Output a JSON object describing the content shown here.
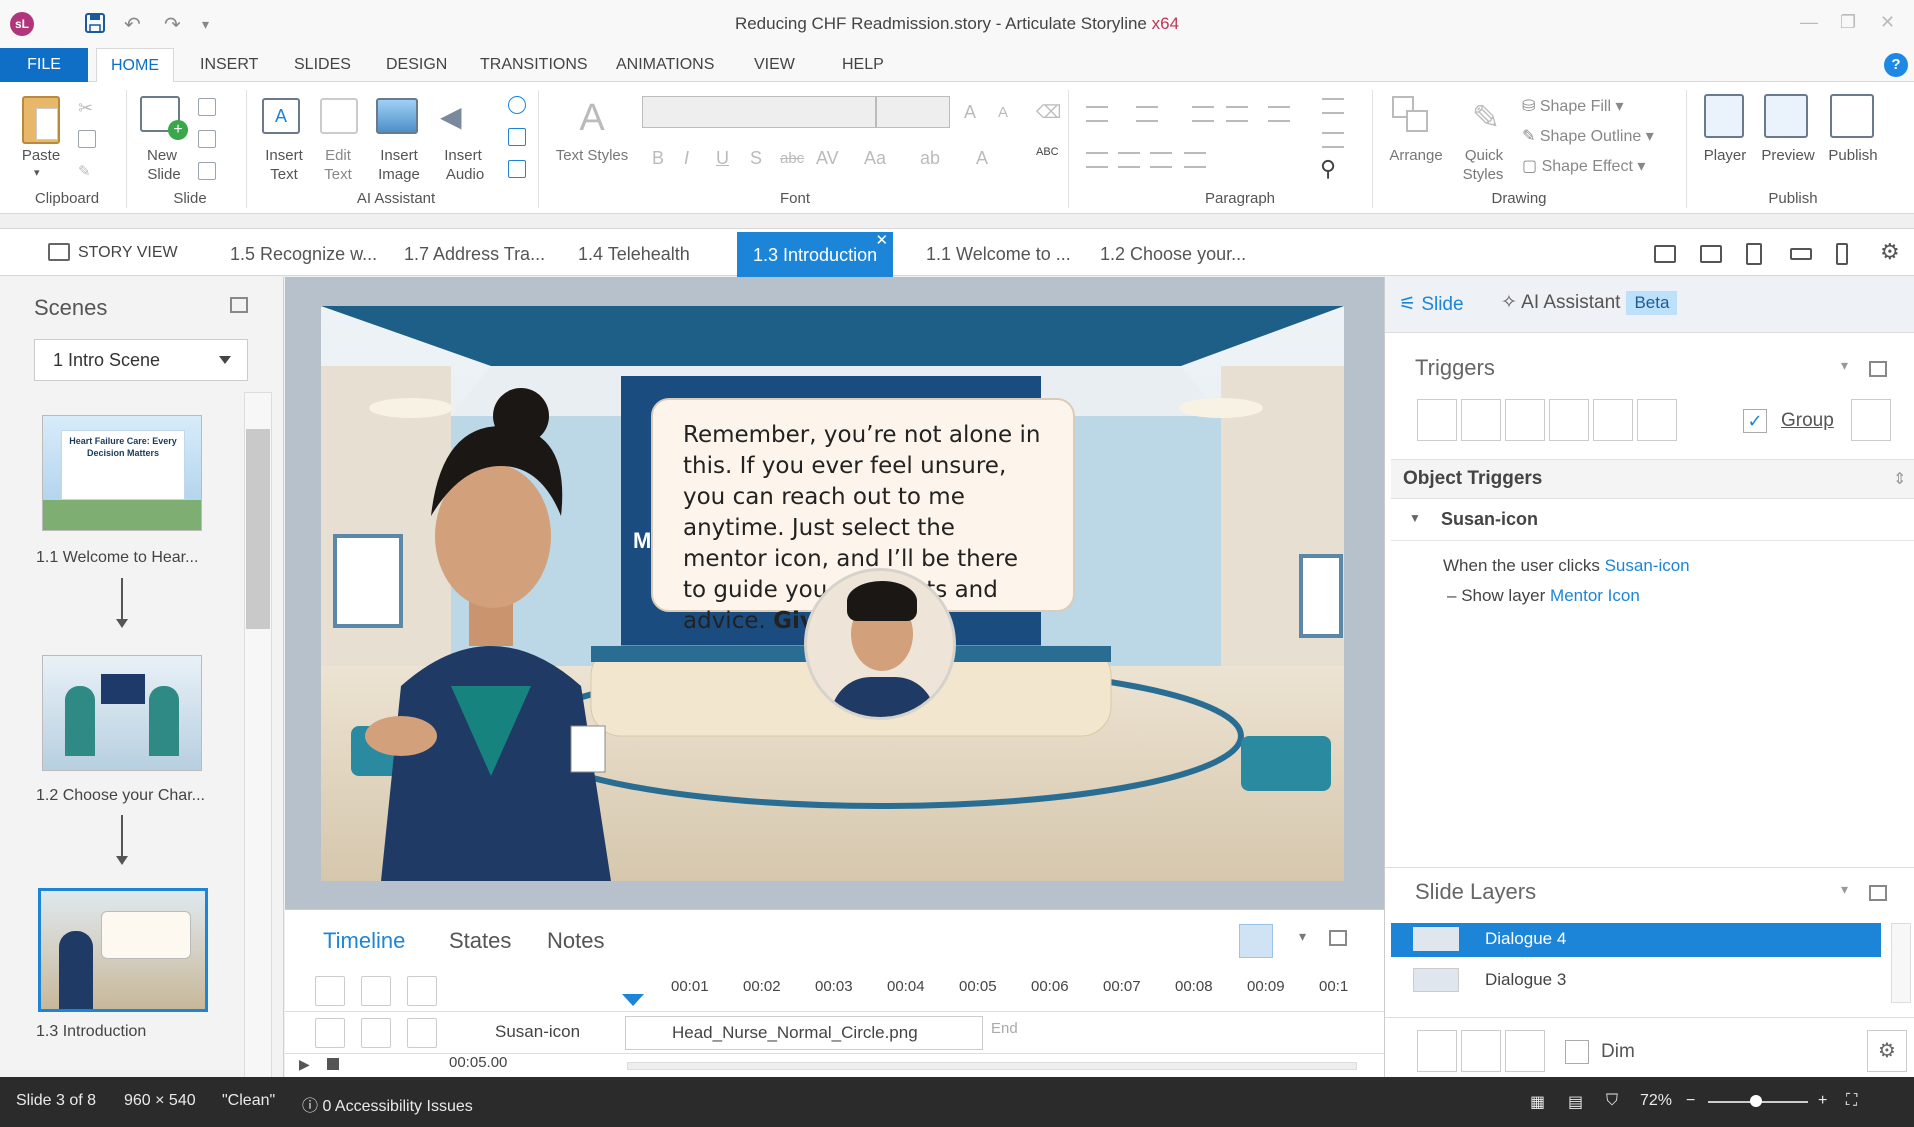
{
  "app": {
    "logo_text": "sL",
    "title": "Reducing CHF Readmission.story - Articulate Storyline",
    "arch": "x64"
  },
  "ribbon_tabs": [
    "FILE",
    "HOME",
    "INSERT",
    "SLIDES",
    "DESIGN",
    "TRANSITIONS",
    "ANIMATIONS",
    "VIEW",
    "HELP"
  ],
  "ribbon": {
    "paste": "Paste",
    "clipboard": "Clipboard",
    "new_slide_1": "New",
    "new_slide_2": "Slide",
    "slide_group": "Slide",
    "insert_text_1": "Insert",
    "insert_text_2": "Text",
    "edit_text_1": "Edit",
    "edit_text_2": "Text",
    "insert_image_1": "Insert",
    "insert_image_2": "Image",
    "insert_audio_1": "Insert",
    "insert_audio_2": "Audio",
    "ai_group": "AI Assistant",
    "text_styles": "Text Styles",
    "font_group": "Font",
    "paragraph_group": "Paragraph",
    "arrange": "Arrange",
    "quick_styles_1": "Quick",
    "quick_styles_2": "Styles",
    "shape_fill": "Shape Fill",
    "shape_outline": "Shape Outline",
    "shape_effect": "Shape Effect",
    "drawing_group": "Drawing",
    "player": "Player",
    "preview": "Preview",
    "publish": "Publish",
    "publish_group": "Publish"
  },
  "slide_tabs": {
    "story_view": "STORY VIEW",
    "tabs": [
      "1.5 Recognize w...",
      "1.7 Address Tra...",
      "1.4 Telehealth",
      "1.3 Introduction",
      "1.1 Welcome to ...",
      "1.2 Choose your..."
    ],
    "active_index": 3
  },
  "scenes": {
    "title": "Scenes",
    "selected_scene": "1 Intro Scene",
    "slides": [
      {
        "caption": "1.1 Welcome to Hear...",
        "thumb_title": "Heart Failure Care: Every Decision Matters"
      },
      {
        "caption": "1.2 Choose your Char..."
      },
      {
        "caption": "1.3 Introduction"
      }
    ]
  },
  "slide": {
    "bubble_text": "Remember, you’re not alone in this. If you ever feel unsure, you can reach out to me anytime. Just select the mentor icon, and I’ll be there to guide you with hints and advice.",
    "bubble_bold": "Give it a try!",
    "wall_letter": "M"
  },
  "timeline": {
    "tabs": [
      "Timeline",
      "States",
      "Notes"
    ],
    "ruler": [
      "00:01",
      "00:02",
      "00:03",
      "00:04",
      "00:05",
      "00:06",
      "00:07",
      "00:08",
      "00:09",
      "00:1"
    ],
    "object_name": "Susan-icon",
    "media_name": "Head_Nurse_Normal_Circle.png",
    "end_label": "End",
    "duration": "00:05.00"
  },
  "right_panel": {
    "tab_slide": "Slide",
    "tab_ai": "AI Assistant",
    "beta": "Beta",
    "triggers_title": "Triggers",
    "group_label": "Group",
    "object_triggers": "Object Triggers",
    "trigger_object": "Susan-icon",
    "trigger_when": "When the user clicks",
    "trigger_target": "Susan-icon",
    "trigger_action": "Show layer",
    "trigger_layer": "Mentor Icon",
    "layers_title": "Slide Layers",
    "layers": [
      "Dialogue 4",
      "Dialogue 3"
    ],
    "dim_label": "Dim"
  },
  "status": {
    "slide_count": "Slide 3 of 8",
    "dimensions": "960 × 540",
    "theme": "\"Clean\"",
    "accessibility": "0 Accessibility Issues",
    "zoom": "72%"
  },
  "colors": {
    "accent": "#1c85d8",
    "file_tab": "#0f6fc6",
    "statusbar": "#2b2b2b"
  }
}
